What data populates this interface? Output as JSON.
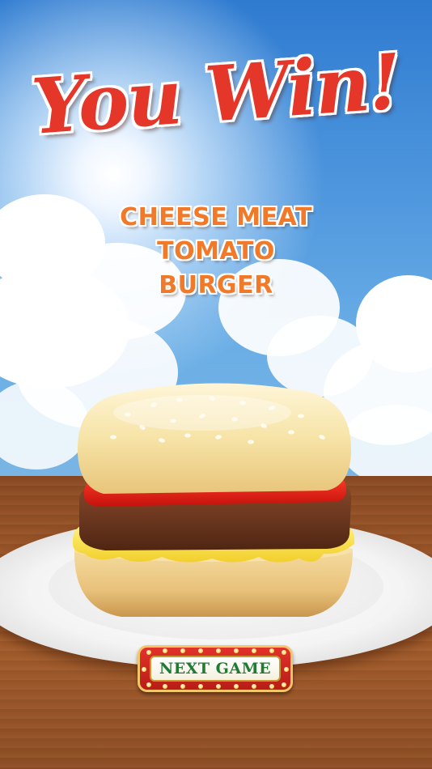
{
  "title": "You Win!",
  "burger_name_lines": [
    "CHEESE MEAT",
    "TOMATO",
    "BURGER"
  ],
  "next_game_button": {
    "label": "NEXT GAME"
  },
  "colors": {
    "title": "#e5362a",
    "burger_name": "#f07a2a",
    "button_frame": "#c8231d",
    "button_text": "#1f7a34",
    "sky": "#4f97de",
    "table": "#9c5628"
  },
  "burger_layers": [
    "top-bun",
    "tomato",
    "meat-patty",
    "cheese",
    "bottom-bun"
  ]
}
